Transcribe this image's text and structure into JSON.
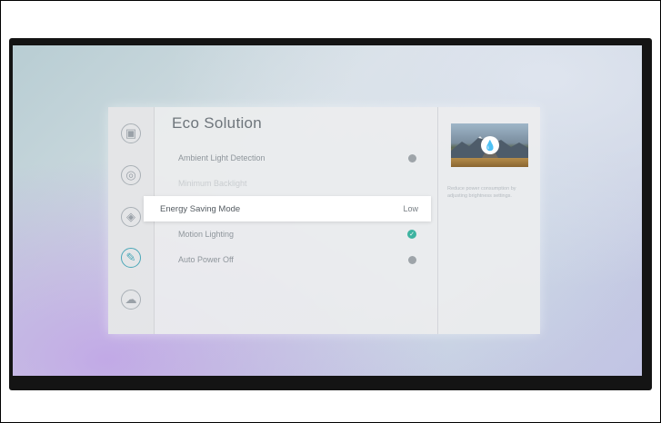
{
  "panel": {
    "title": "Eco Solution"
  },
  "rail": {
    "items": [
      {
        "icon": "picture-icon",
        "glyph": "▣"
      },
      {
        "icon": "sound-icon",
        "glyph": "◎"
      },
      {
        "icon": "broadcasting-icon",
        "glyph": "◈"
      },
      {
        "icon": "general-icon",
        "glyph": "✎",
        "active": true
      },
      {
        "icon": "support-icon",
        "glyph": "☁"
      }
    ]
  },
  "menu": {
    "items": [
      {
        "label": "Ambient Light Detection",
        "state": "off"
      },
      {
        "label": "Minimum Backlight",
        "value": "",
        "disabled": true
      },
      {
        "label": "Energy Saving Mode",
        "value": "Low",
        "focused": true
      },
      {
        "label": "Motion Lighting",
        "state": "on"
      },
      {
        "label": "Auto Power Off",
        "state": "off"
      }
    ]
  },
  "info": {
    "text": "Reduce power consumption by adjusting brightness settings."
  },
  "colors": {
    "accent": "#3db3a0",
    "rail_active": "#4aa7b8",
    "panel_bg": "#ecedee"
  }
}
